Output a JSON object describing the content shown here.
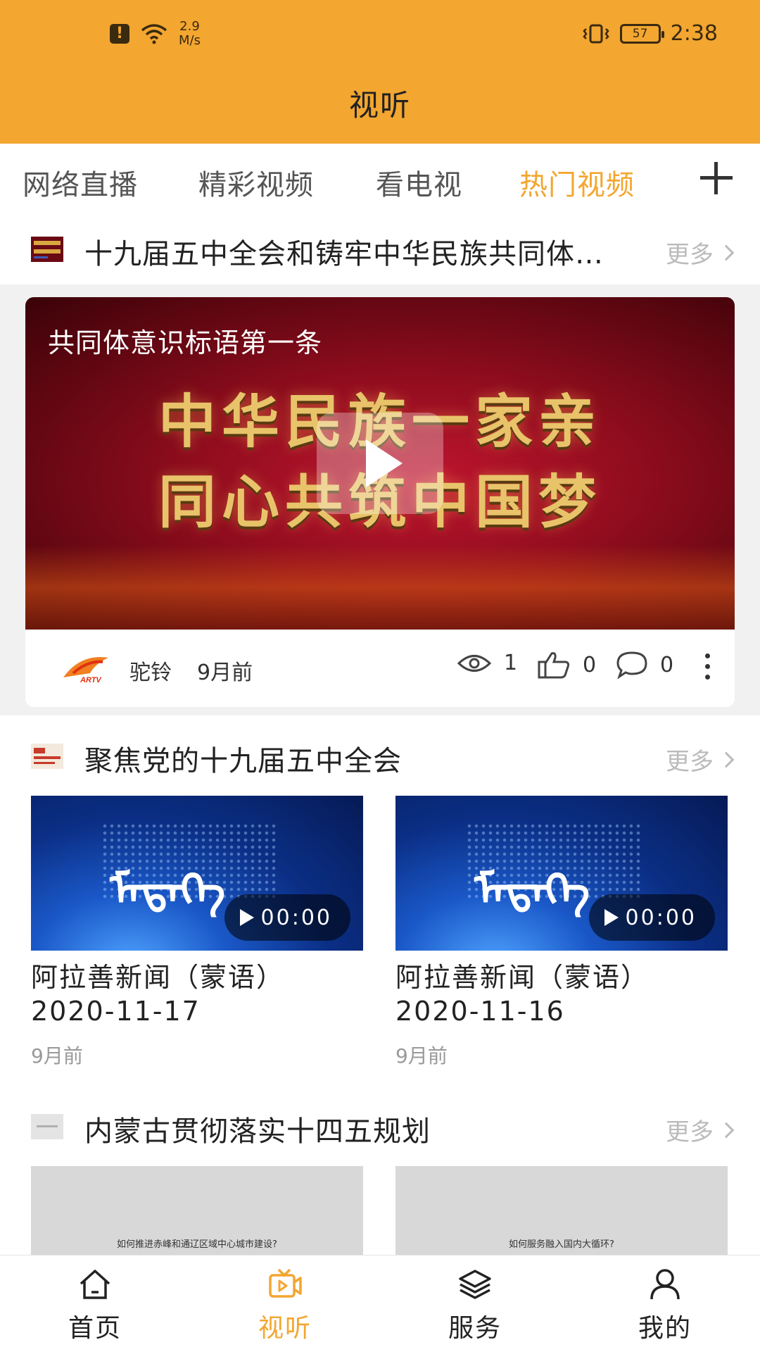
{
  "status_bar": {
    "network_speed": "2.9",
    "speed_unit": "M/s",
    "battery": "57",
    "time": "2:38"
  },
  "header": {
    "title": "视听"
  },
  "tabs": [
    {
      "label": "网络直播"
    },
    {
      "label": "精彩视频"
    },
    {
      "label": "看电视"
    },
    {
      "label": "热门视频",
      "active": true
    }
  ],
  "colors": {
    "accent": "#f3a630"
  },
  "sections": [
    {
      "title": "十九届五中全会和铸牢中华民族共同体意识…",
      "more": "更多",
      "feature": {
        "caption": "共同体意识标语第一条",
        "art_line1": "中华民族一家亲",
        "art_line2": "同心共筑中国梦",
        "logo_text": "ARTV",
        "author": "驼铃",
        "ago": "9月前",
        "views": "1",
        "likes": "0",
        "comments": "0"
      }
    },
    {
      "title": "聚焦党的十九届五中全会",
      "more": "更多",
      "items": [
        {
          "title": "阿拉善新闻（蒙语）2020-11-17",
          "ago": "9月前",
          "duration": "00:00",
          "thumb_text": "ᠮᠡᠳᠡᠭᠡ"
        },
        {
          "title": "阿拉善新闻（蒙语）2020-11-16",
          "ago": "9月前",
          "duration": "00:00",
          "thumb_text": "ᠮᠡᠳᠡᠭᠡ"
        }
      ]
    },
    {
      "title": "内蒙古贯彻落实十四五规划",
      "more": "更多",
      "items": [
        {
          "caption": "如何推进赤峰和通辽区域中心城市建设?"
        },
        {
          "caption": "如何服务融入国内大循环?"
        }
      ]
    }
  ],
  "bottom_nav": [
    {
      "label": "首页",
      "icon": "home-icon"
    },
    {
      "label": "视听",
      "icon": "video-icon",
      "active": true
    },
    {
      "label": "服务",
      "icon": "layers-icon"
    },
    {
      "label": "我的",
      "icon": "user-icon"
    }
  ]
}
